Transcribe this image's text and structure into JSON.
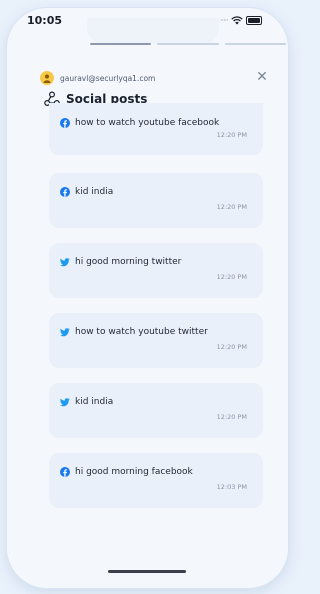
{
  "status_bar": {
    "time": "10:05"
  },
  "header": {
    "email": "gauravl@securlyqa1.com",
    "title": "Social posts"
  },
  "posts": [
    {
      "platform": "facebook",
      "text": "how to watch youtube facebook",
      "time": "12:20 PM"
    },
    {
      "platform": "facebook",
      "text": "kid india",
      "time": "12:20 PM"
    },
    {
      "platform": "twitter",
      "text": "hi good morning twitter",
      "time": "12:20 PM"
    },
    {
      "platform": "twitter",
      "text": "how to watch youtube twitter",
      "time": "12:20 PM"
    },
    {
      "platform": "twitter",
      "text": "kid india",
      "time": "12:20 PM"
    },
    {
      "platform": "facebook",
      "text": "hi good morning facebook",
      "time": "12:03 PM"
    }
  ],
  "colors": {
    "facebook": "#1877f2",
    "twitter": "#1d9bf0"
  }
}
